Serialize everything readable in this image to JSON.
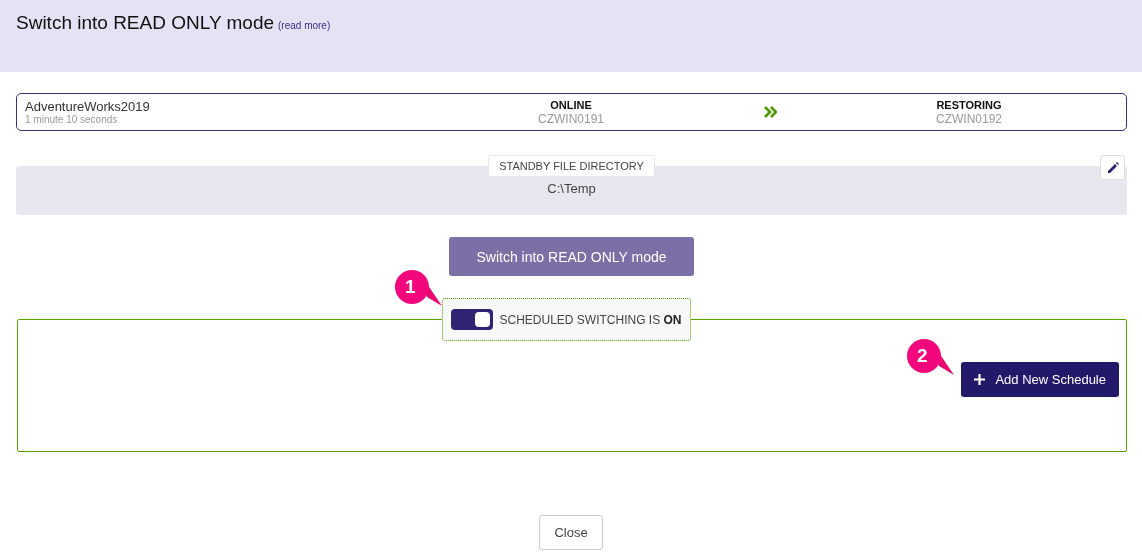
{
  "header": {
    "title": "Switch into READ ONLY mode",
    "link": "(read more)"
  },
  "database": {
    "name": "AdventureWorks2019",
    "elapsed": "1 minute 10 seconds",
    "source": {
      "state": "ONLINE",
      "server": "CZWIN0191"
    },
    "target": {
      "state": "RESTORING",
      "server": "CZWIN0192"
    }
  },
  "standby": {
    "label": "STANDBY FILE DIRECTORY",
    "path": "C:\\Temp"
  },
  "switch_button": "Switch into READ ONLY mode",
  "schedule": {
    "toggle": {
      "on": true,
      "label": "SCHEDULED SWITCHING IS **ON**"
    },
    "add_button": "Add New Schedule"
  },
  "callouts": [
    "1",
    "2"
  ],
  "close_button": "Close"
}
